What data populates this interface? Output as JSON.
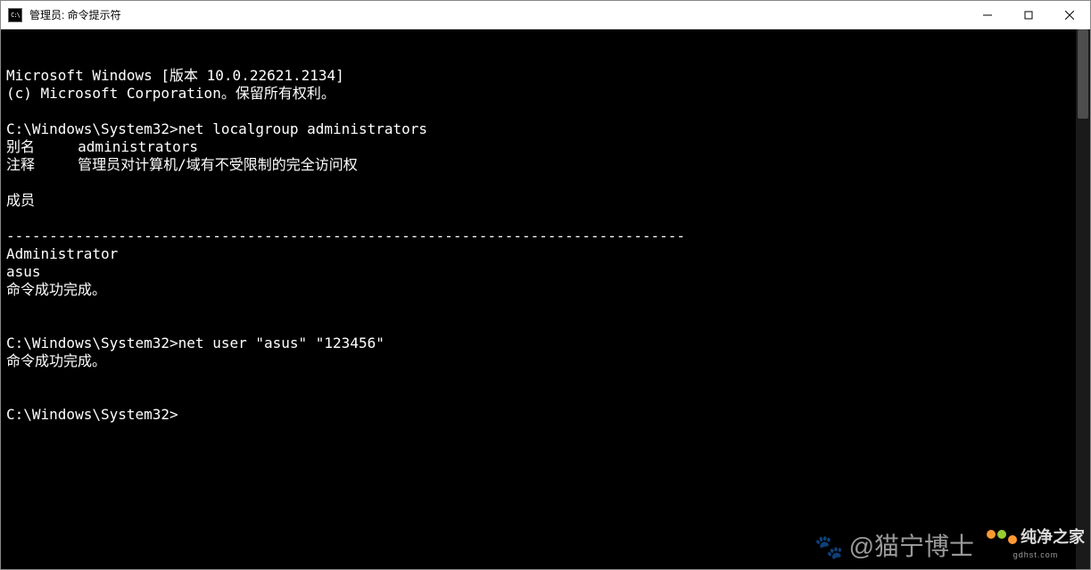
{
  "window": {
    "title": "管理员: 命令提示符",
    "app_icon_text": "C:\\"
  },
  "terminal": {
    "lines": [
      "Microsoft Windows [版本 10.0.22621.2134]",
      "(c) Microsoft Corporation。保留所有权利。",
      "",
      "C:\\Windows\\System32>net localgroup administrators",
      "别名     administrators",
      "注释     管理员对计算机/域有不受限制的完全访问权",
      "",
      "成员",
      "",
      "-------------------------------------------------------------------------------",
      "Administrator",
      "asus",
      "命令成功完成。",
      "",
      "",
      "C:\\Windows\\System32>net user \"asus\" \"123456\"",
      "命令成功完成。",
      "",
      "",
      "C:\\Windows\\System32>"
    ]
  },
  "watermarks": {
    "baidu": "@猫宁博士",
    "site_name": "纯净之家",
    "site_url": "gdhst.com"
  }
}
